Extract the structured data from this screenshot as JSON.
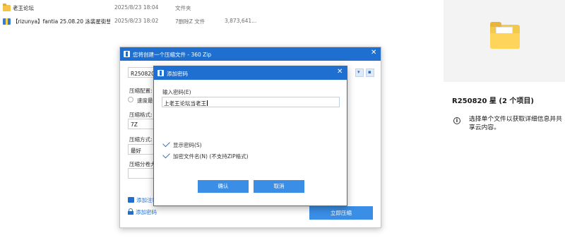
{
  "file_list": {
    "rows": [
      {
        "name": "老王论坛",
        "date": "2025/8/23 18:04",
        "type": "文件夹",
        "size": "",
        "icon": "folder-icon"
      },
      {
        "name": "【rizunya】fantia 25.08.20 泳装星街彗...",
        "date": "2025/8/23 18:02",
        "type": "7删除Z 文件",
        "size": "3,873,641...",
        "icon": "archive-icon"
      }
    ]
  },
  "details": {
    "title": "R250820 星 (2 个项目)",
    "info": "选择单个文件以获取详细信息并共享云内容。",
    "info_icon": "i"
  },
  "zip_window": {
    "title": "您将创建一个压缩文件 - 360 Zip",
    "close": "✕",
    "filename": "R250820 星",
    "btn_dropdown": "▾",
    "btn_folder": "▪",
    "compress_config_label": "压缩配置:",
    "speed_label": "速度最",
    "format_label": "压缩格式:",
    "format_value": "7Z",
    "method_label": "压缩方式:",
    "method_value": "最好",
    "volume_label": "压缩分卷大小",
    "add_comment": "添加注释",
    "add_password": "添加密码",
    "start_button": "立即压缩"
  },
  "password_dialog": {
    "title": "添加密码",
    "close": "✕",
    "input_label": "输入密码(E)",
    "password_value": "上老王论坛当老王",
    "show_password": "显示密码(S)",
    "encrypt_filenames": "加密文件名(N) (不支持ZIP格式)",
    "ok": "确认",
    "cancel": "取消"
  },
  "colors": {
    "accent": "#1e6fcf",
    "button": "#3a8ee6",
    "folder": "#f4c446"
  }
}
